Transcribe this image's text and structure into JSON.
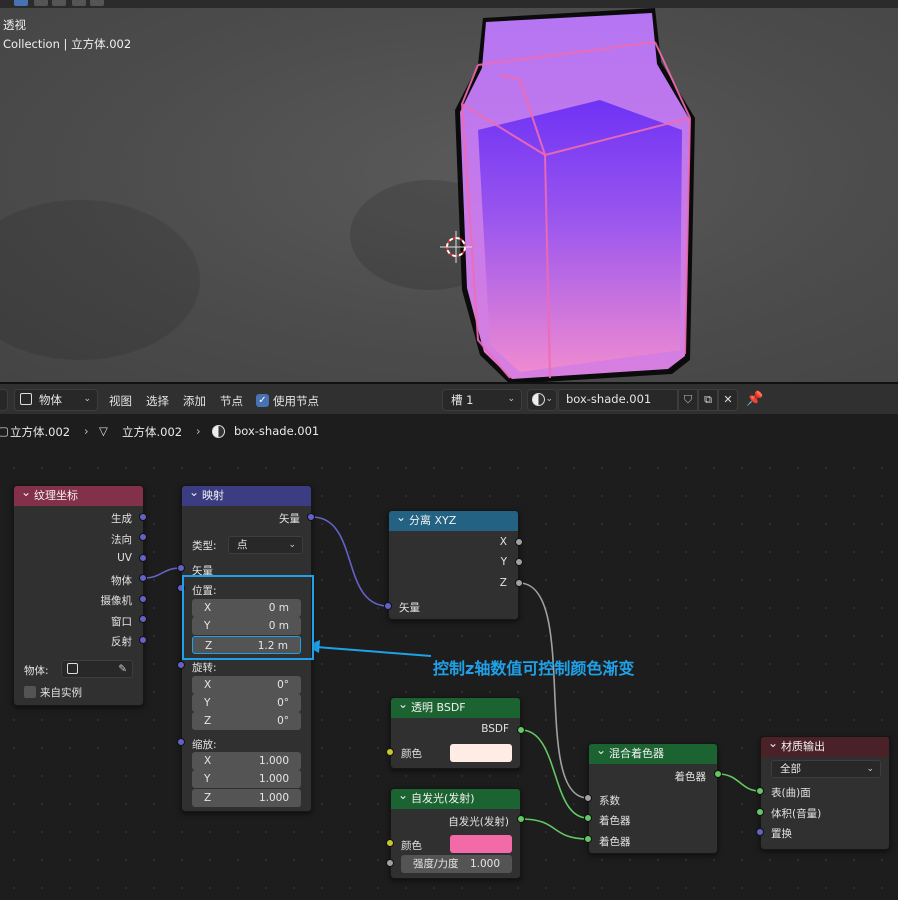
{
  "viewport": {
    "view_label": "透视",
    "collection_label": "Collection | 立方体.002"
  },
  "header": {
    "mode_label": "物体",
    "menus": [
      "视图",
      "选择",
      "添加",
      "节点"
    ],
    "use_nodes_label": "使用节点",
    "use_nodes_checked": true,
    "slot_label": "槽 1",
    "material_name": "box-shade.001"
  },
  "breadcrumb": [
    "立方体.002",
    "立方体.002",
    "box-shade.001"
  ],
  "nodes": {
    "tex_coord": {
      "title": "纹理坐标",
      "outputs": [
        "生成",
        "法向",
        "UV",
        "物体",
        "摄像机",
        "窗口",
        "反射"
      ],
      "object_label": "物体:",
      "from_instancer_label": "来自实例"
    },
    "mapping": {
      "title": "映射",
      "output": "矢量",
      "type_label": "类型:",
      "type_value": "点",
      "vector_label": "矢量",
      "location_label": "位置:",
      "location": [
        {
          "axis": "X",
          "value": "0 m"
        },
        {
          "axis": "Y",
          "value": "0 m"
        },
        {
          "axis": "Z",
          "value": "1.2 m"
        }
      ],
      "rotation_label": "旋转:",
      "rotation": [
        {
          "axis": "X",
          "value": "0°"
        },
        {
          "axis": "Y",
          "value": "0°"
        },
        {
          "axis": "Z",
          "value": "0°"
        }
      ],
      "scale_label": "缩放:",
      "scale": [
        {
          "axis": "X",
          "value": "1.000"
        },
        {
          "axis": "Y",
          "value": "1.000"
        },
        {
          "axis": "Z",
          "value": "1.000"
        }
      ]
    },
    "separate_xyz": {
      "title": "分离 XYZ",
      "outputs": [
        "X",
        "Y",
        "Z"
      ],
      "input": "矢量"
    },
    "transparent": {
      "title": "透明 BSDF",
      "output": "BSDF",
      "color_label": "颜色"
    },
    "emission": {
      "title": "自发光(发射)",
      "output": "自发光(发射)",
      "color_label": "颜色",
      "strength_label": "强度/力度",
      "strength_value": "1.000"
    },
    "mix_shader": {
      "title": "混合着色器",
      "output": "着色器",
      "inputs": [
        "系数",
        "着色器",
        "着色器"
      ]
    },
    "material_output": {
      "title": "材质输出",
      "target": "全部",
      "inputs": [
        "表(曲)面",
        "体积(音量)",
        "置换"
      ]
    }
  },
  "annotation": {
    "text": "控制z轴数值可控制颜色渐变"
  },
  "colors": {
    "accent": "#1ea1e8",
    "tex_coord_header": "#83314a",
    "mapping_header": "#3c3c83",
    "separate_header": "#246283",
    "shader_header": "#1b6330",
    "output_header": "#4b2128",
    "transparent_color": "#ffece4",
    "emission_color": "#f26aa8"
  }
}
